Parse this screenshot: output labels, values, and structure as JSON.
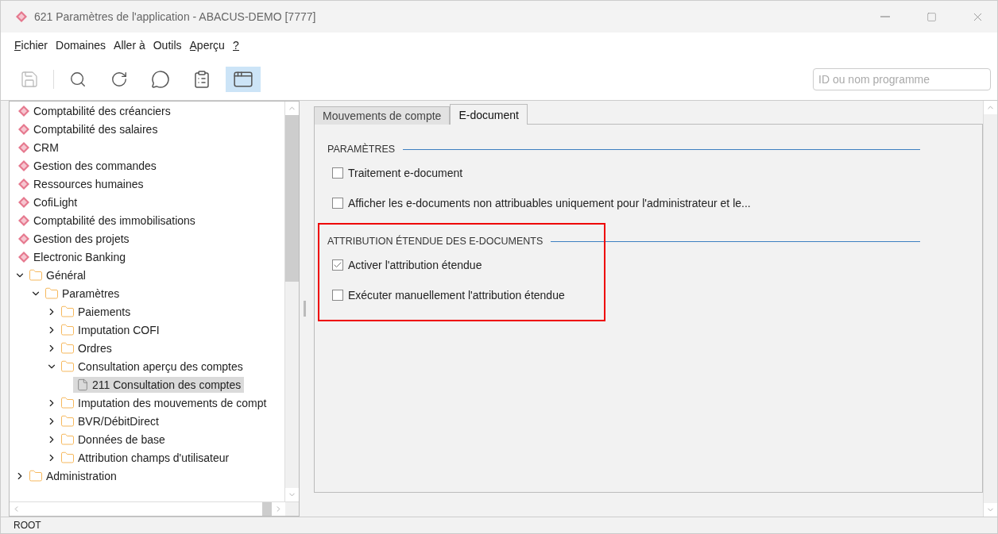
{
  "window": {
    "title": "621 Paramètres de l'application - ABACUS-DEMO [7777]"
  },
  "menu": [
    {
      "label": "Fichier",
      "mnemonic": true
    },
    {
      "label": "Domaines",
      "mnemonic": false
    },
    {
      "label": "Aller à",
      "mnemonic": false
    },
    {
      "label": "Outils",
      "mnemonic": false
    },
    {
      "label": "Aperçu",
      "mnemonic": true
    },
    {
      "label": "?",
      "mnemonic": true
    }
  ],
  "toolbar": [
    {
      "kind": "save",
      "disabled": true,
      "selected": false
    },
    {
      "kind": "separator"
    },
    {
      "kind": "search",
      "disabled": false,
      "selected": false
    },
    {
      "kind": "refresh",
      "disabled": false,
      "selected": false
    },
    {
      "kind": "comment-add",
      "disabled": false,
      "selected": false
    },
    {
      "kind": "clipboard-add",
      "disabled": false,
      "selected": false
    },
    {
      "kind": "window",
      "disabled": false,
      "selected": true
    }
  ],
  "search": {
    "placeholder": "ID ou nom programme"
  },
  "tree": [
    {
      "kind": "module",
      "label": "Comptabilité des créanciers",
      "selected": false
    },
    {
      "kind": "module",
      "label": "Comptabilité des salaires",
      "selected": false
    },
    {
      "kind": "module",
      "label": "CRM",
      "selected": false
    },
    {
      "kind": "module",
      "label": "Gestion des commandes",
      "selected": false
    },
    {
      "kind": "module",
      "label": "Ressources humaines",
      "selected": false
    },
    {
      "kind": "module",
      "label": "CofiLight",
      "selected": false
    },
    {
      "kind": "module",
      "label": "Comptabilité des immobilisations",
      "selected": false
    },
    {
      "kind": "module",
      "label": "Gestion des projets",
      "selected": false
    },
    {
      "kind": "module",
      "label": "Electronic Banking",
      "selected": false
    },
    {
      "kind": "folder",
      "label": "Général",
      "expanded": true,
      "selected": false,
      "children": [
        {
          "kind": "folder",
          "label": "Paramètres",
          "expanded": true,
          "selected": false,
          "children": [
            {
              "kind": "folder",
              "label": "Paiements",
              "expanded": false,
              "selected": false
            },
            {
              "kind": "folder",
              "label": "Imputation COFI",
              "expanded": false,
              "selected": false
            },
            {
              "kind": "folder",
              "label": "Ordres",
              "expanded": false,
              "selected": false
            },
            {
              "kind": "folder",
              "label": "Consultation aperçu des comptes",
              "expanded": true,
              "selected": false,
              "children": [
                {
                  "kind": "program",
                  "label": "211 Consultation des comptes",
                  "selected": true
                }
              ]
            },
            {
              "kind": "folder",
              "label": "Imputation des mouvements de compt",
              "expanded": false,
              "selected": false
            },
            {
              "kind": "folder",
              "label": "BVR/DébitDirect",
              "expanded": false,
              "selected": false
            },
            {
              "kind": "folder",
              "label": "Données de base",
              "expanded": false,
              "selected": false
            },
            {
              "kind": "folder",
              "label": "Attribution champs d'utilisateur",
              "expanded": false,
              "selected": false
            }
          ]
        }
      ]
    },
    {
      "kind": "folder",
      "label": "Administration",
      "expanded": false,
      "selected": false
    }
  ],
  "tabs": [
    {
      "label": "Mouvements de compte",
      "selected": false
    },
    {
      "label": "E-document",
      "selected": true
    }
  ],
  "sections": [
    {
      "title": "PARAMÈTRES",
      "highlighted": false,
      "options": [
        {
          "label": "Traitement e-document",
          "checked": false
        },
        {
          "label": "Afficher les e-documents non attribuables uniquement pour l'administrateur et le...",
          "checked": false
        }
      ]
    },
    {
      "title": "ATTRIBUTION ÉTENDUE DES E-DOCUMENTS",
      "highlighted": true,
      "options": [
        {
          "label": "Activer l'attribution étendue",
          "checked": true
        },
        {
          "label": "Exécuter manuellement l'attribution étendue",
          "checked": false
        }
      ]
    }
  ],
  "status_bar": {
    "text": "ROOT"
  }
}
